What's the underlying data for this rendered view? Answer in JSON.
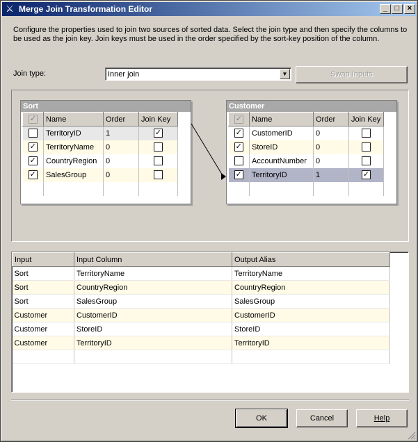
{
  "window": {
    "title": "Merge Join Transformation Editor",
    "minimize": "_",
    "maximize": "□",
    "close": "×"
  },
  "description": "Configure the properties used to join two sources of sorted data. Select the join type and then specify the columns to be used as the join key. Join keys must be used in the order specified by the sort-key position of the column.",
  "join": {
    "label": "Join type:",
    "value": "Inner join",
    "swap_label": "Swap Inputs"
  },
  "left_input": {
    "title": "Sort",
    "headers": [
      "Name",
      "Order",
      "Join Key"
    ],
    "rows": [
      {
        "name": "TerritoryID",
        "order": "1",
        "selected": false,
        "join_key": true
      },
      {
        "name": "TerritoryName",
        "order": "0",
        "selected": true,
        "join_key": false
      },
      {
        "name": "CountryRegion",
        "order": "0",
        "selected": true,
        "join_key": false
      },
      {
        "name": "SalesGroup",
        "order": "0",
        "selected": true,
        "join_key": false
      }
    ]
  },
  "right_input": {
    "title": "Customer",
    "headers": [
      "Name",
      "Order",
      "Join Key"
    ],
    "rows": [
      {
        "name": "CustomerID",
        "order": "0",
        "selected": true,
        "join_key": false
      },
      {
        "name": "StoreID",
        "order": "0",
        "selected": true,
        "join_key": false
      },
      {
        "name": "AccountNumber",
        "order": "0",
        "selected": false,
        "join_key": false
      },
      {
        "name": "TerritoryID",
        "order": "1",
        "selected": true,
        "join_key": true
      }
    ]
  },
  "output": {
    "headers": [
      "Input",
      "Input Column",
      "Output Alias"
    ],
    "rows": [
      {
        "input": "Sort",
        "column": "TerritoryName",
        "alias": "TerritoryName"
      },
      {
        "input": "Sort",
        "column": "CountryRegion",
        "alias": "CountryRegion"
      },
      {
        "input": "Sort",
        "column": "SalesGroup",
        "alias": "SalesGroup"
      },
      {
        "input": "Customer",
        "column": "CustomerID",
        "alias": "CustomerID"
      },
      {
        "input": "Customer",
        "column": "StoreID",
        "alias": "StoreID"
      },
      {
        "input": "Customer",
        "column": "TerritoryID",
        "alias": "TerritoryID"
      }
    ]
  },
  "buttons": {
    "ok": "OK",
    "cancel": "Cancel",
    "help": "Help"
  },
  "colors": {
    "titlebar_start": "#0a246a",
    "titlebar_end": "#a6caf0",
    "row_alt": "#fffbe6",
    "row_selected": "#b2b4c8"
  }
}
